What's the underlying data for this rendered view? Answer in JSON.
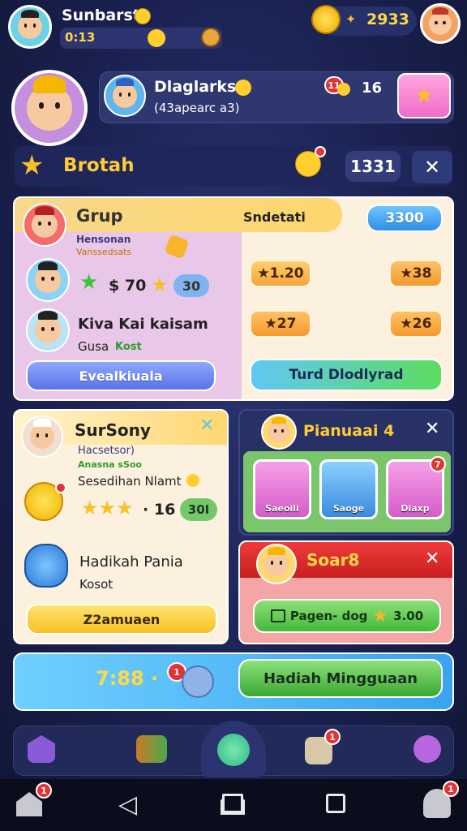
{
  "top": {
    "player_name": "Sunbarst",
    "player_sub": "0:13",
    "coins": "2933"
  },
  "profile": {
    "name": "Dlaglarks",
    "sub": "(43apearc a3)",
    "badge": "11",
    "count": "16"
  },
  "section": {
    "title": "Brotah",
    "count": "1331"
  },
  "group": {
    "title": "Grup",
    "header_right": "Sndetati",
    "header_pill": "3300",
    "line1": "Hensonan",
    "line2": "Vanssedsats",
    "stat_value": "70",
    "stat_pill": "30",
    "member_name": "Kiva Kai kaisam",
    "member_sub": "Gusa",
    "member_sub_tag": "Kost",
    "chips": [
      "1.20",
      "38",
      "27",
      "26"
    ],
    "button_left": "Evealkiuala",
    "button_right": "Turd Dlodlyrad"
  },
  "survey": {
    "title": "SurSony",
    "line1": "Hacsetsor)",
    "line2": "Anasna sSoo",
    "line3": "Sesedihan Nlamt",
    "score_right": "16",
    "score_pill": "30I",
    "gift_title": "Hadikah Pania",
    "gift_sub": "Kosot",
    "button": "Z2amuaen"
  },
  "pianuaai": {
    "title": "Pianuaai 4",
    "gifts": [
      "Saeoili",
      "Saoge",
      "Diaxp"
    ],
    "gift_badge": "7"
  },
  "soar": {
    "title": "Soar8",
    "button_label": "Pagen- dog",
    "button_value": "3.00"
  },
  "bottom_bar": {
    "timer": "7:88",
    "badge": "1",
    "action": "Hadiah Mingguaan"
  },
  "nav_badges": {
    "mail": "1",
    "home": "1",
    "profile": "1"
  }
}
